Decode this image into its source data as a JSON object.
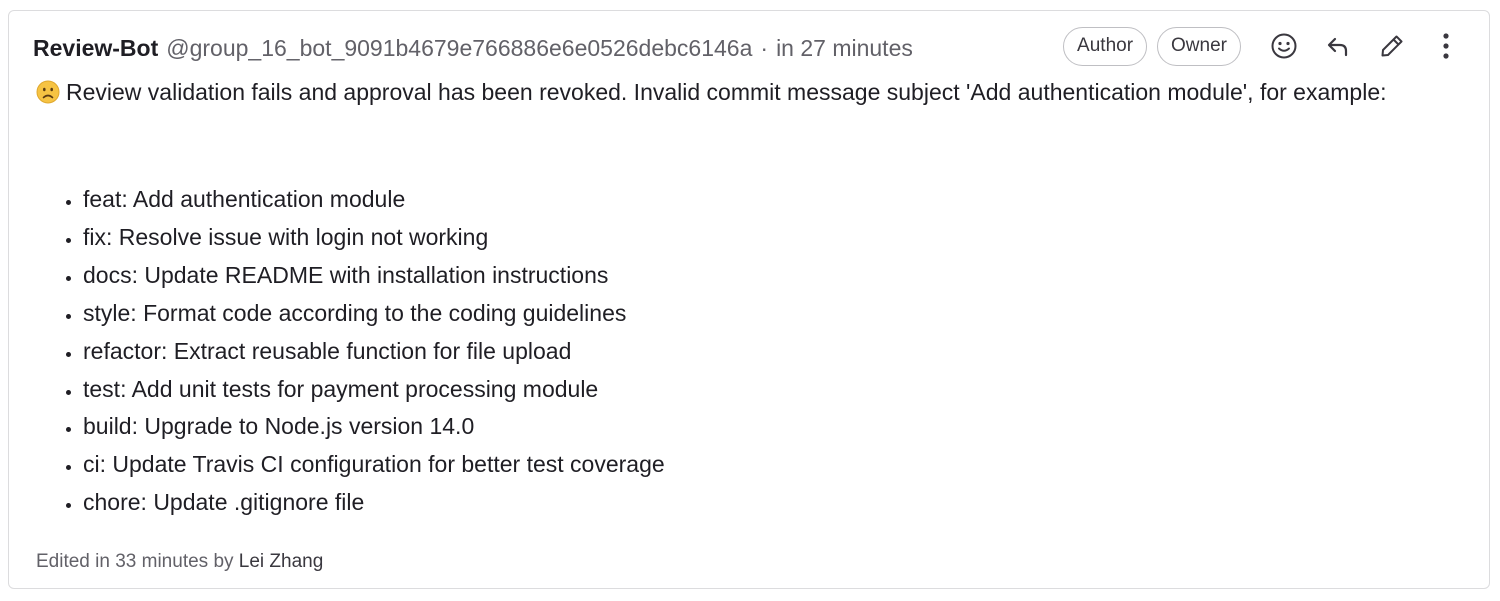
{
  "note": {
    "author_name": "Review-Bot",
    "author_handle": "@group_16_bot_9091b4679e766886e6e0526debc6146a",
    "separator": "·",
    "time": "in 27 minutes",
    "badges": [
      "Author",
      "Owner"
    ],
    "action_icons": [
      "emoji-reaction-icon",
      "reply-icon",
      "edit-pencil-icon",
      "more-actions-icon"
    ],
    "message_emoji": "slightly-frowning-face-icon",
    "message": "Review validation fails and approval has been revoked. Invalid commit message subject 'Add authentication module', for example:",
    "examples": [
      "feat: Add authentication module",
      "fix: Resolve issue with login not working",
      "docs: Update README with installation instructions",
      "style: Format code according to the coding guidelines",
      "refactor: Extract reusable function for file upload",
      "test: Add unit tests for payment processing module",
      "build: Upgrade to Node.js version 14.0",
      "ci: Update Travis CI configuration for better test coverage",
      "chore: Update .gitignore file"
    ],
    "edited_prefix": "Edited in 33 minutes by",
    "edited_by": "Lei Zhang"
  },
  "colors": {
    "border": "#dcdcde",
    "text": "#1f1e24",
    "muted": "#626168",
    "emoji_face": "#f6c343"
  }
}
